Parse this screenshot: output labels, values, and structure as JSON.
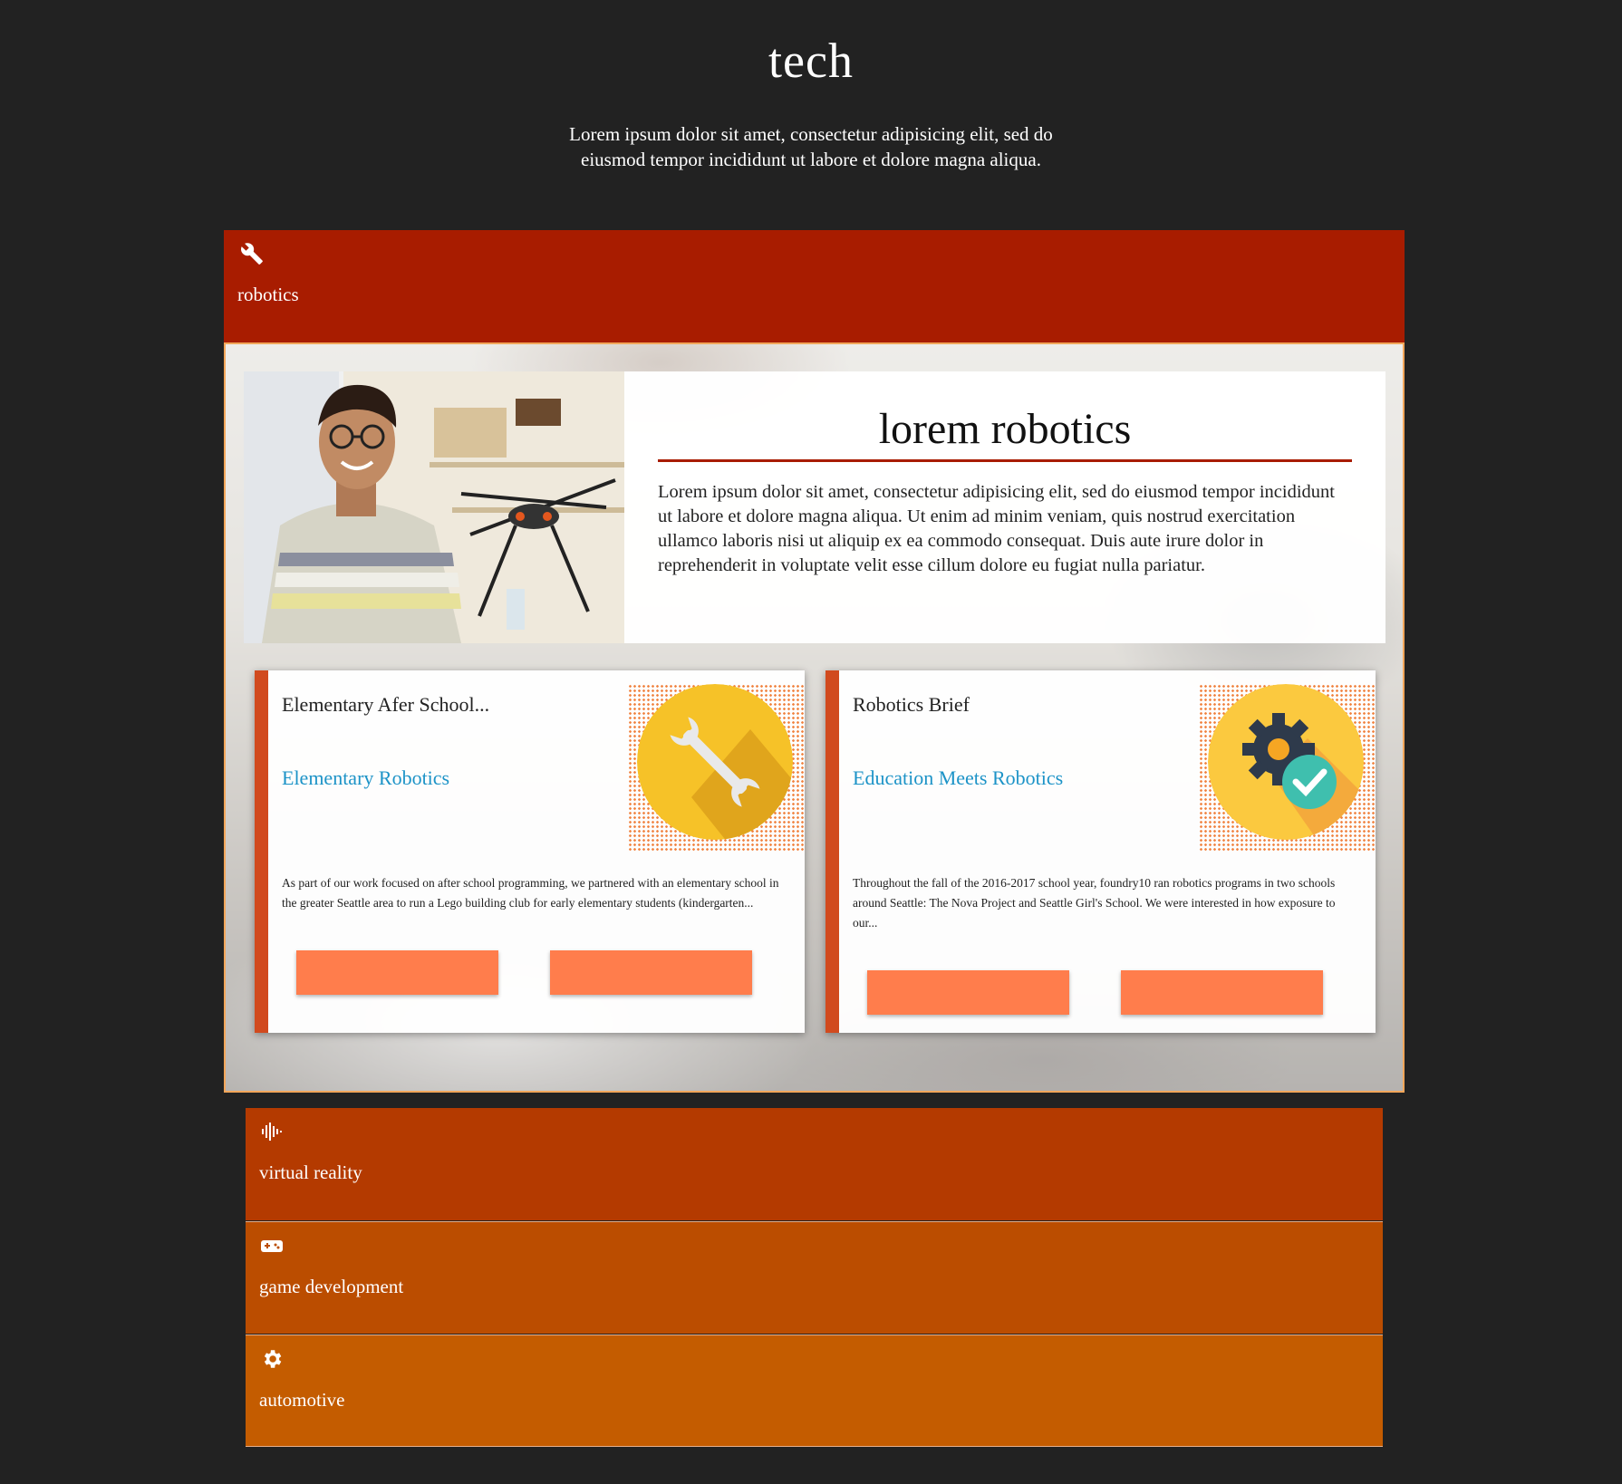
{
  "header": {
    "title": "tech",
    "subtitle": "Lorem ipsum dolor sit amet, consectetur adipisicing elit, sed do eiusmod tempor incididunt ut labore et dolore magna aliqua."
  },
  "accordion": {
    "robotics": {
      "label": "robotics",
      "icon": "wrench-icon",
      "color": "#a81c00"
    },
    "virtual_reality": {
      "label": "virtual reality",
      "icon": "audio-wave-icon",
      "color": "#b43a00"
    },
    "game_development": {
      "label": "game development",
      "icon": "gamepad-icon",
      "color": "#bb4d00"
    },
    "automotive": {
      "label": "automotive",
      "icon": "gear-icon",
      "color": "#c45c00"
    }
  },
  "robotics_panel": {
    "hero": {
      "heading": "lorem robotics",
      "body": "Lorem ipsum dolor sit amet, consectetur adipisicing elit, sed do eiusmod tempor incididunt ut labore et dolore magna aliqua. Ut enim ad minim veniam, quis nostrud exercitation ullamco laboris nisi ut aliquip ex ea commodo consequat. Duis aute irure dolor in reprehenderit in voluptate velit esse cillum dolore eu fugiat nulla pariatur."
    },
    "cards": [
      {
        "title": "Elementary Afer School...",
        "subtitle": "Elementary Robotics",
        "description": "As part of our work focused on after school programming, we partnered with an elementary school in the greater Seattle area to run a Lego building club for early elementary students (kindergarten...",
        "icon": "wrench-icon"
      },
      {
        "title": "Robotics Brief",
        "subtitle": "Education Meets Robotics",
        "description": "Throughout the fall of the 2016-2017 school year, foundry10 ran robotics programs in two schools around Seattle: The Nova Project and Seattle Girl's School. We were interested in how exposure to our...",
        "icon": "gear-check-icon"
      }
    ]
  },
  "colors": {
    "background": "#222222",
    "accent_red": "#a81c00",
    "card_stripe": "#d14a1e",
    "button": "#ff7d4c",
    "link": "#1c93c7",
    "icon_circle": "#f6c228"
  }
}
